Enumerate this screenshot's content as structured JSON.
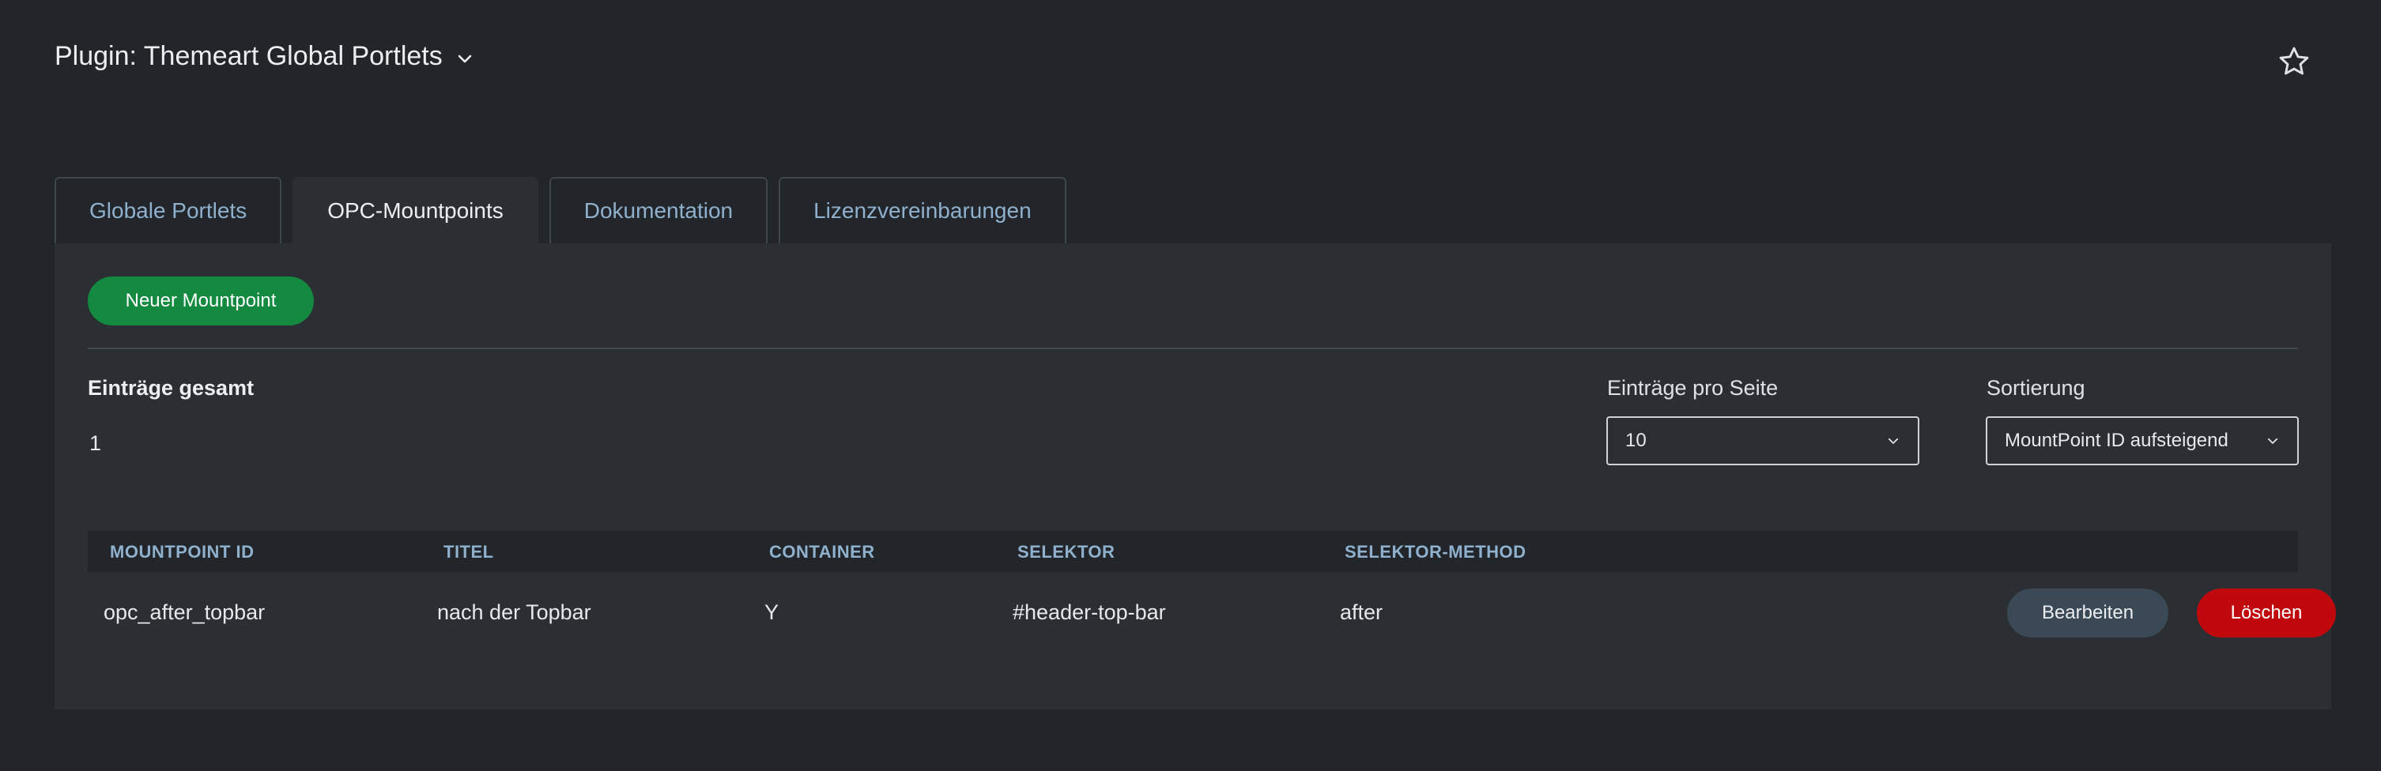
{
  "header": {
    "title": "Plugin: Themeart Global Portlets"
  },
  "tabs": [
    {
      "label": "Globale Portlets",
      "active": false
    },
    {
      "label": "OPC-Mountpoints",
      "active": true
    },
    {
      "label": "Dokumentation",
      "active": false
    },
    {
      "label": "Lizenzvereinbarungen",
      "active": false
    }
  ],
  "panel": {
    "new_button_label": "Neuer Mountpoint",
    "total_label": "Einträge gesamt",
    "total_value": "1",
    "per_page": {
      "label": "Einträge pro Seite",
      "value": "10"
    },
    "sorting": {
      "label": "Sortierung",
      "value": "MountPoint ID aufsteigend"
    }
  },
  "table": {
    "columns": [
      "MOUNTPOINT ID",
      "TITEL",
      "CONTAINER",
      "SELEKTOR",
      "SELEKTOR-METHOD"
    ],
    "rows": [
      {
        "cells": [
          "opc_after_topbar",
          "nach der Topbar",
          "Y",
          "#header-top-bar",
          "after"
        ],
        "edit_label": "Bearbeiten",
        "delete_label": "Löschen"
      }
    ]
  },
  "colors": {
    "background": "#222529",
    "panel": "#2b2f34",
    "accent_link": "#8fb1cd",
    "success": "#138a40",
    "danger": "#c0090d",
    "secondary": "#3b4856"
  },
  "icons": {
    "title_toggle": "chevron-down-icon",
    "favorite": "star-icon",
    "select_arrow": "chevron-down-icon"
  }
}
